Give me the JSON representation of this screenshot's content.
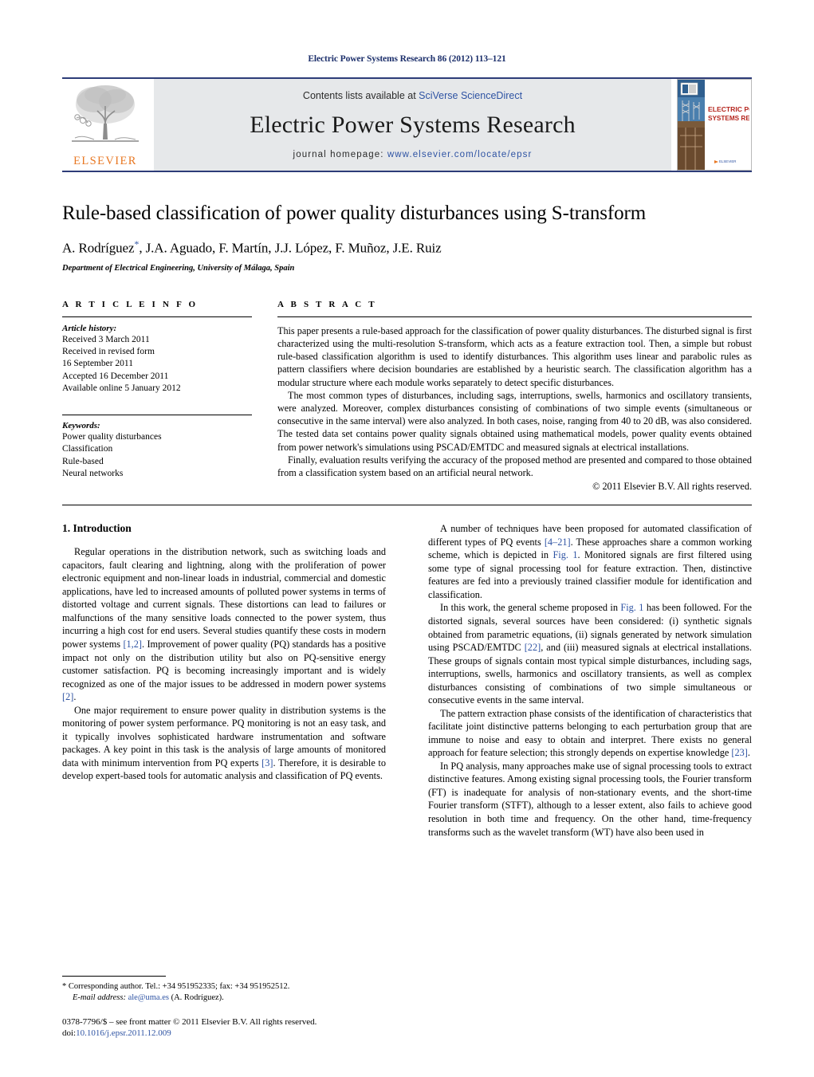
{
  "running_head": "Electric Power Systems Research 86 (2012) 113–121",
  "masthead": {
    "publisher_logo_word": "ELSEVIER",
    "contents_prefix": "Contents lists available at ",
    "contents_link": "SciVerse ScienceDirect",
    "journal_name": "Electric Power Systems Research",
    "homepage_prefix": "journal homepage:",
    "homepage_url": "www.elsevier.com/locate/epsr",
    "cover": {
      "line1": "ELECTRIC POWER",
      "line2": "SYSTEMS RESEARCH",
      "footer_word": "ELSEVIER"
    }
  },
  "article": {
    "title": "Rule-based classification of power quality disturbances using S-transform",
    "authors": "A. Rodríguez",
    "authors_rest": ", J.A. Aguado, F. Martín, J.J. López, F. Muñoz, J.E. Ruiz",
    "corresponding_marker": "*",
    "affiliation": "Department of Electrical Engineering, University of Málaga, Spain"
  },
  "info": {
    "heading": "A R T I C L E  I N F O",
    "history_label": "Article history:",
    "history": [
      "Received 3 March 2011",
      "Received in revised form",
      "16 September 2011",
      "Accepted 16 December 2011",
      "Available online 5 January 2012"
    ],
    "keywords_label": "Keywords:",
    "keywords": [
      "Power quality disturbances",
      "Classification",
      "Rule-based",
      "Neural networks"
    ]
  },
  "abstract": {
    "heading": "A B S T R A C T",
    "paragraphs": [
      "This paper presents a rule-based approach for the classification of power quality disturbances. The disturbed signal is first characterized using the multi-resolution S-transform, which acts as a feature extraction tool. Then, a simple but robust rule-based classification algorithm is used to identify disturbances. This algorithm uses linear and parabolic rules as pattern classifiers where decision boundaries are established by a heuristic search. The classification algorithm has a modular structure where each module works separately to detect specific disturbances.",
      "The most common types of disturbances, including sags, interruptions, swells, harmonics and oscillatory transients, were analyzed. Moreover, complex disturbances consisting of combinations of two simple events (simultaneous or consecutive in the same interval) were also analyzed. In both cases, noise, ranging from 40 to 20 dB, was also considered. The tested data set contains power quality signals obtained using mathematical models, power quality events obtained from power network's simulations using PSCAD/EMTDC and measured signals at electrical installations.",
      "Finally, evaluation results verifying the accuracy of the proposed method are presented and compared to those obtained from a classification system based on an artificial neural network."
    ],
    "copyright": "© 2011 Elsevier B.V. All rights reserved."
  },
  "introduction": {
    "heading": "1. Introduction",
    "left_paragraphs": [
      "Regular operations in the distribution network, such as switching loads and capacitors, fault clearing and lightning, along with the proliferation of power electronic equipment and non-linear loads in industrial, commercial and domestic applications, have led to increased amounts of polluted power systems in terms of distorted voltage and current signals. These distortions can lead to failures or malfunctions of the many sensitive loads connected to the power system, thus incurring a high cost for end users. Several studies quantify these costs in modern power systems [1,2]. Improvement of power quality (PQ) standards has a positive impact not only on the distribution utility but also on PQ-sensitive energy customer satisfaction. PQ is becoming increasingly important and is widely recognized as one of the major issues to be addressed in modern power systems [2].",
      "One major requirement to ensure power quality in distribution systems is the monitoring of power system performance. PQ monitoring is not an easy task, and it typically involves sophisticated hardware instrumentation and software packages. A key point in this task is the analysis of large amounts of monitored data with minimum intervention from PQ experts [3]. Therefore, it is desirable to develop expert-based tools for automatic analysis and classification of PQ events."
    ],
    "right_paragraphs": [
      "A number of techniques have been proposed for automated classification of different types of PQ events [4–21]. These approaches share a common working scheme, which is depicted in Fig. 1. Monitored signals are first filtered using some type of signal processing tool for feature extraction. Then, distinctive features are fed into a previously trained classifier module for identification and classification.",
      "In this work, the general scheme proposed in Fig. 1 has been followed. For the distorted signals, several sources have been considered: (i) synthetic signals obtained from parametric equations, (ii) signals generated by network simulation using PSCAD/EMTDC [22], and (iii) measured signals at electrical installations. These groups of signals contain most typical simple disturbances, including sags, interruptions, swells, harmonics and oscillatory transients, as well as complex disturbances consisting of combinations of two simple simultaneous or consecutive events in the same interval.",
      "The pattern extraction phase consists of the identification of characteristics that facilitate joint distinctive patterns belonging to each perturbation group that are immune to noise and easy to obtain and interpret. There exists no general approach for feature selection; this strongly depends on expertise knowledge [23].",
      "In PQ analysis, many approaches make use of signal processing tools to extract distinctive features. Among existing signal processing tools, the Fourier transform (FT) is inadequate for analysis of non-stationary events, and the short-time Fourier transform (STFT), although to a lesser extent, also fails to achieve good resolution in both time and frequency. On the other hand, time-frequency transforms such as the wavelet transform (WT) have also been used in"
    ]
  },
  "footnotes": {
    "corresponding": "* Corresponding author. Tel.: +34 951952335; fax: +34 951952512.",
    "email_label": "E-mail address:",
    "email": "ale@uma.es",
    "email_owner": "(A. Rodríguez).",
    "issn_line": "0378-7796/$ – see front matter © 2011 Elsevier B.V. All rights reserved.",
    "doi_label": "doi:",
    "doi": "10.1016/j.epsr.2011.12.009"
  },
  "colors": {
    "link": "#2e53a3",
    "rule": "#2d3c78",
    "elsevier_orange": "#e87722",
    "masthead_bg": "#e6e8ea"
  }
}
